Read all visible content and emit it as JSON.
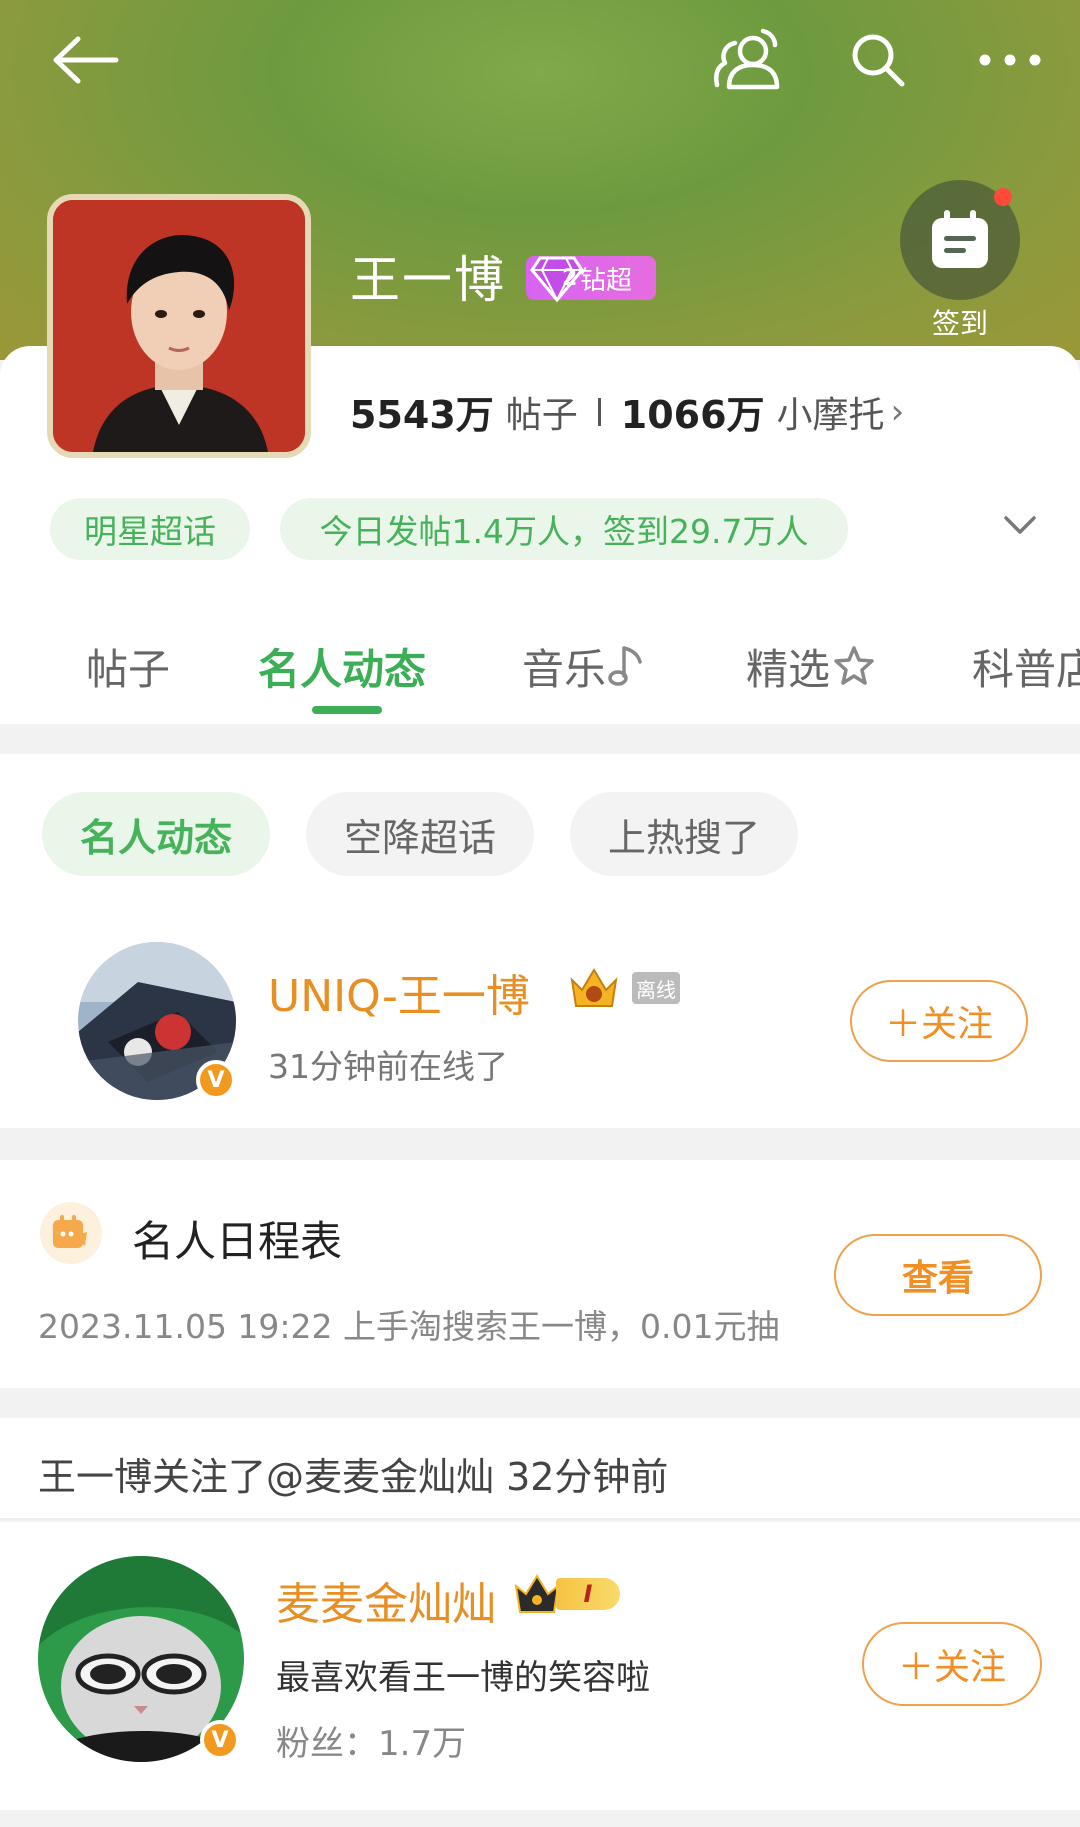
{
  "header": {
    "title": "王一博",
    "badge_level": "2",
    "badge_text": "钻超",
    "checkin_label": "签到"
  },
  "stats": {
    "posts_count": "5543万",
    "posts_label": "帖子",
    "fans_count": "1066万",
    "fans_label": "小摩托",
    "chevron": "›"
  },
  "tags": {
    "category": "明星超话",
    "activity": "今日发帖1.4万人，签到29.7万人"
  },
  "tabs": [
    {
      "label": "帖子"
    },
    {
      "label": "名人动态"
    },
    {
      "label": "音乐"
    },
    {
      "label": "精选"
    },
    {
      "label": "科普店"
    }
  ],
  "filters": [
    {
      "label": "名人动态"
    },
    {
      "label": "空降超话"
    },
    {
      "label": "上热搜了"
    }
  ],
  "online_user": {
    "name": "UNIQ-王一博",
    "status_tag": "离线",
    "status_text": "31分钟前在线了",
    "follow_label": "＋关注",
    "verify_mark": "V"
  },
  "schedule": {
    "title": "名人日程表",
    "detail": "2023.11.05 19:22 上手淘搜索王一博，0.01元抽",
    "view_label": "查看"
  },
  "follow_event": {
    "text": "王一博关注了@麦麦金灿灿 32分钟前"
  },
  "followed_user": {
    "name": "麦麦金灿灿",
    "level": "I",
    "bio": "最喜欢看王一博的笑容啦",
    "fans": "粉丝：1.7万",
    "follow_label": "＋关注",
    "verify_mark": "V"
  },
  "colors": {
    "accent_green": "#3cae55",
    "accent_orange": "#f08f24",
    "badge_purple": "#d763f2"
  }
}
